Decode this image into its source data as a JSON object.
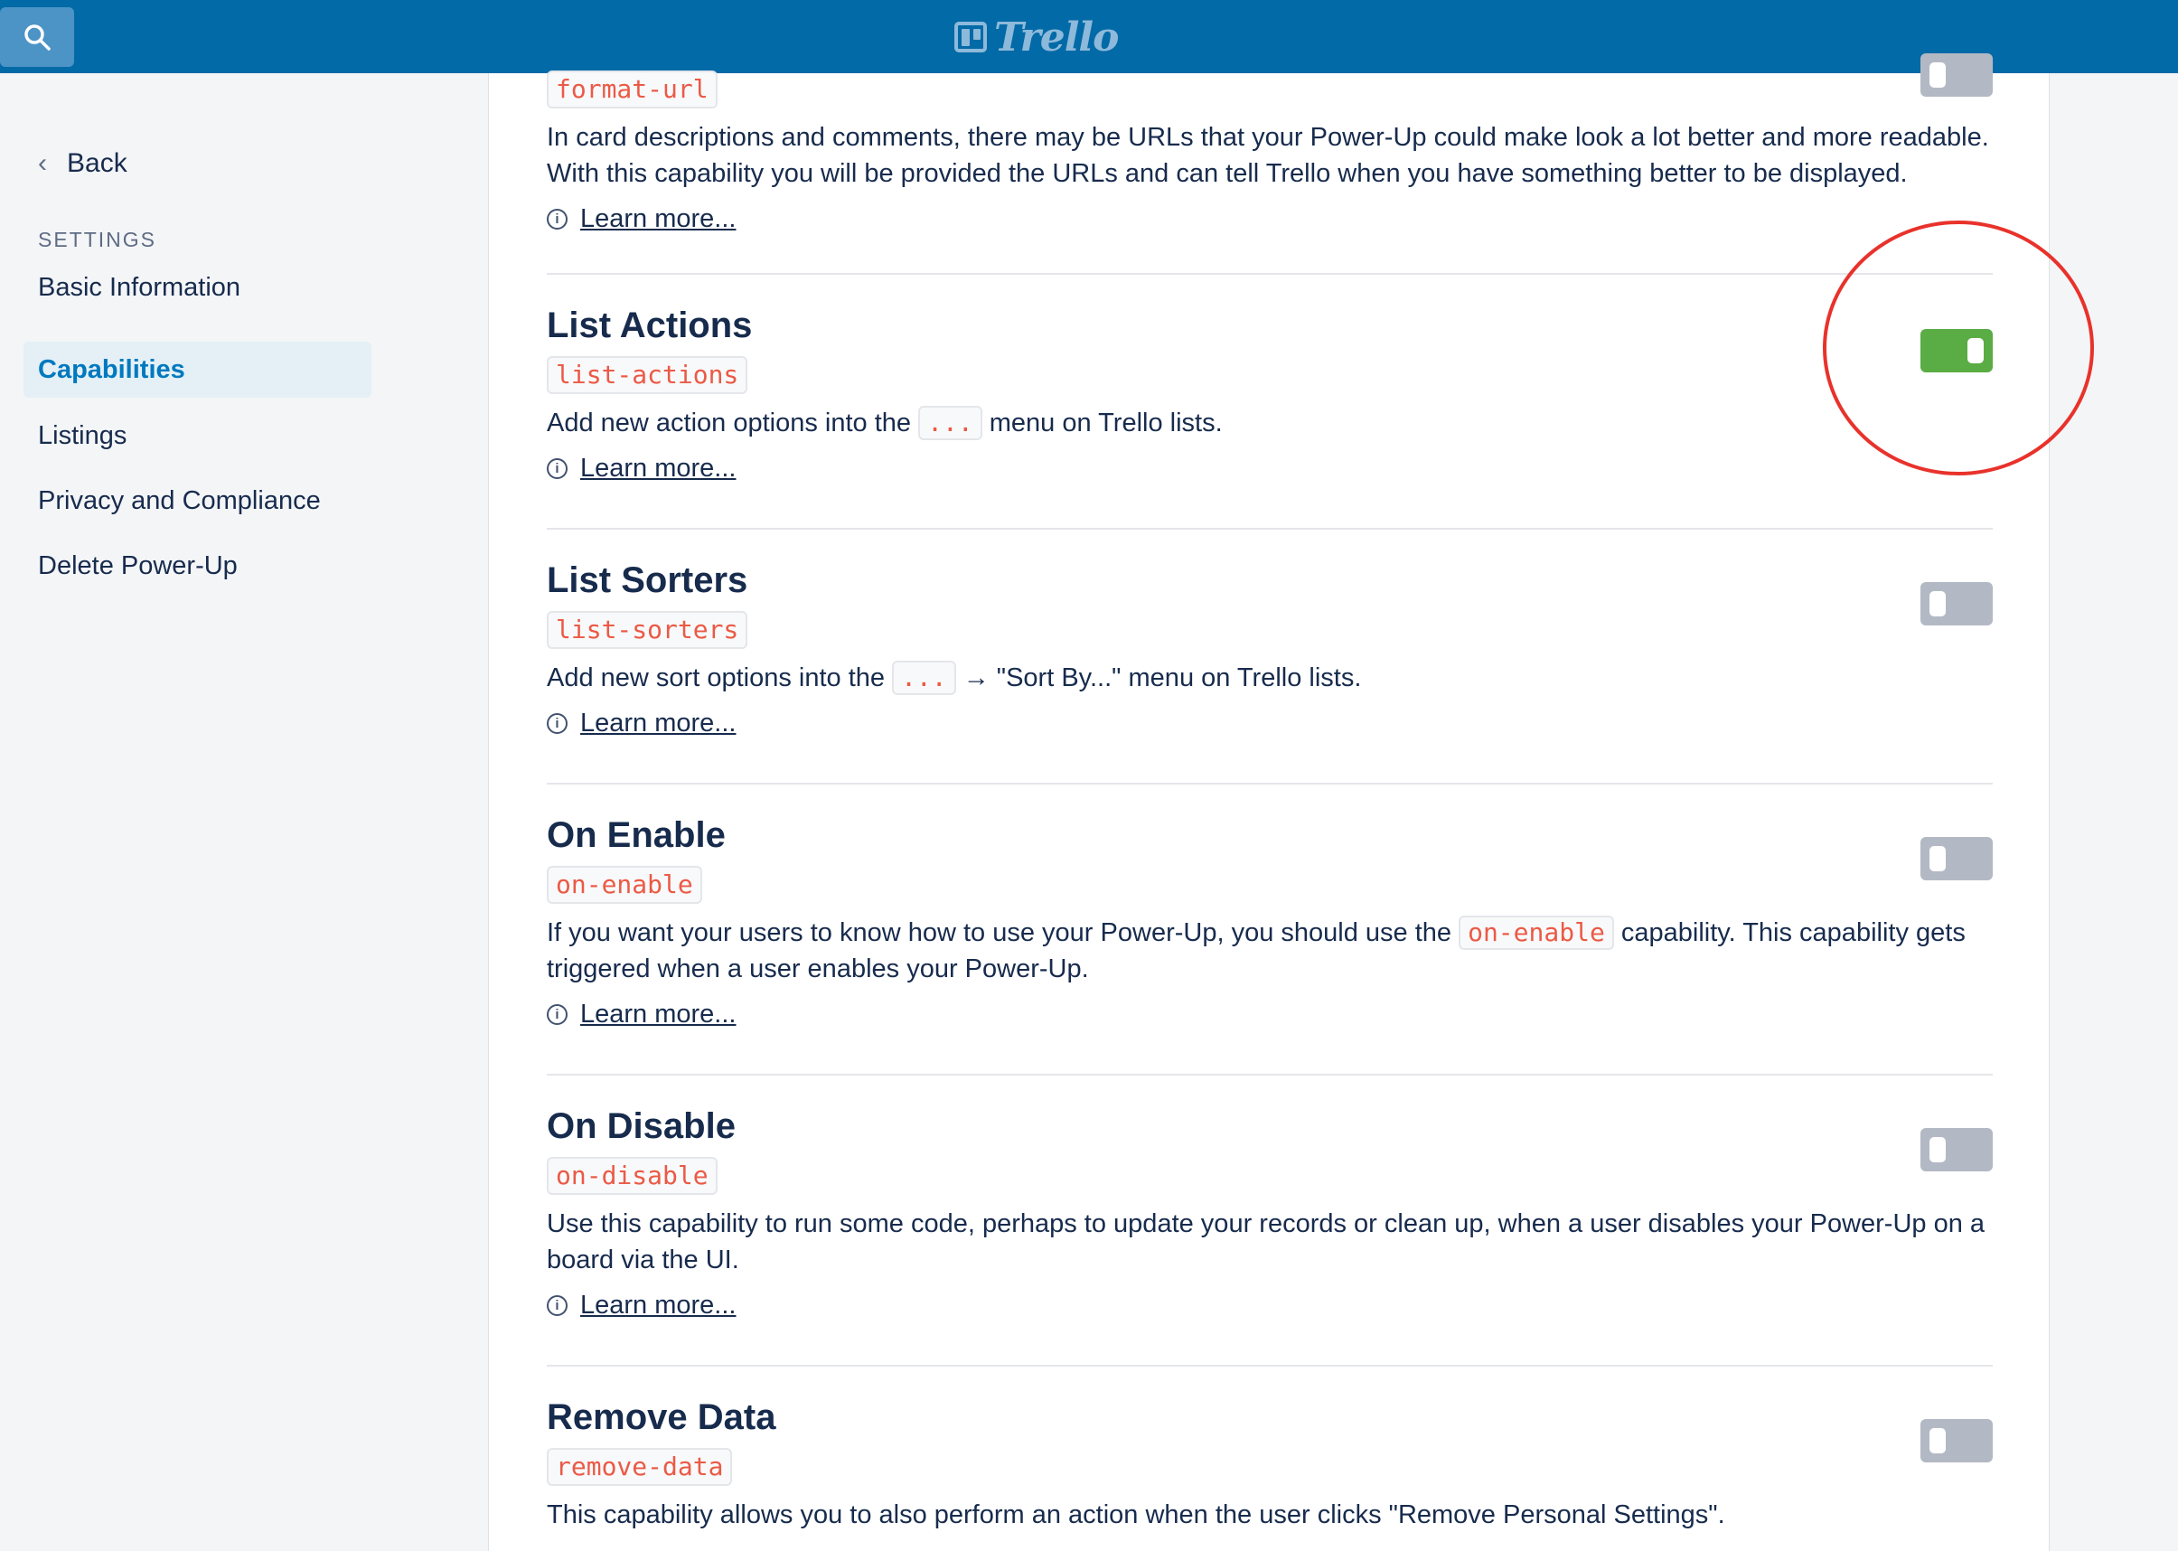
{
  "topbar": {
    "brand": "Trello"
  },
  "sidebar": {
    "back_label": "Back",
    "section_label": "SETTINGS",
    "items": [
      {
        "label": "Basic Information",
        "active": false
      },
      {
        "label": "Capabilities",
        "active": true
      },
      {
        "label": "Listings",
        "active": false
      },
      {
        "label": "Privacy and Compliance",
        "active": false
      },
      {
        "label": "Delete Power-Up",
        "active": false
      }
    ]
  },
  "capabilities": {
    "format_url": {
      "code": "format-url",
      "desc_line1": "In card descriptions and comments, there may be URLs that your Power-Up could make look a lot better and more readable.",
      "desc_line2": "With this capability you will be provided the URLs and can tell Trello when you have something better to be displayed.",
      "learn": "Learn more..."
    },
    "list_actions": {
      "title": "List Actions",
      "code": "list-actions",
      "desc_before": "Add new action options into the",
      "desc_code": "...",
      "desc_after": "menu on Trello lists.",
      "learn": "Learn more...",
      "enabled": true
    },
    "list_sorters": {
      "title": "List Sorters",
      "code": "list-sorters",
      "desc_before": "Add new sort options into the",
      "desc_code": "...",
      "desc_after": "→ \"Sort By...\" menu on Trello lists.",
      "learn": "Learn more...",
      "enabled": false
    },
    "on_enable": {
      "title": "On Enable",
      "code": "on-enable",
      "desc_before": "If you want your users to know how to use your Power-Up, you should use the",
      "desc_code": "on-enable",
      "desc_after": "capability. This capability gets",
      "desc_line2": "triggered when a user enables your Power-Up.",
      "learn": "Learn more...",
      "enabled": false
    },
    "on_disable": {
      "title": "On Disable",
      "code": "on-disable",
      "desc_line1": "Use this capability to run some code, perhaps to update your records or clean up, when a user disables your Power-Up on a",
      "desc_line2": "board via the UI.",
      "learn": "Learn more...",
      "enabled": false
    },
    "remove_data": {
      "title": "Remove Data",
      "code": "remove-data",
      "desc": "This capability allows you to also perform an action when the user clicks \"Remove Personal Settings\".",
      "enabled": false
    }
  },
  "colors": {
    "topbar": "#026aa7",
    "toggle_on": "#5aac44",
    "toggle_off": "#b3b9c4",
    "code_text": "#eb5a46",
    "annotation": "#e8322b",
    "active_nav": "#0079bf"
  }
}
